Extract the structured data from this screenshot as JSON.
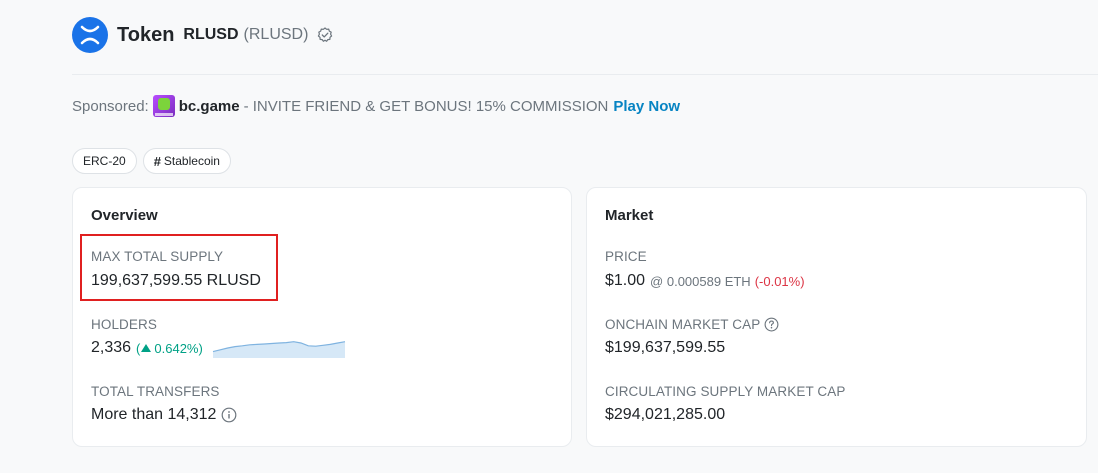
{
  "header": {
    "label": "Token",
    "name": "RLUSD",
    "symbol": "(RLUSD)"
  },
  "sponsor": {
    "prefix": "Sponsored:",
    "brand": "bc.game",
    "text": "- INVITE FRIEND & GET BONUS! 15% COMMISSION",
    "cta": "Play Now"
  },
  "tags": [
    {
      "label": "ERC-20"
    },
    {
      "label": "Stablecoin",
      "icon": "hash-icon"
    }
  ],
  "overview": {
    "title": "Overview",
    "max_supply_label": "MAX TOTAL SUPPLY",
    "max_supply_value": "199,637,599.55 RLUSD",
    "holders_label": "HOLDERS",
    "holders_value": "2,336",
    "holders_change": "0.642%)",
    "holders_change_prefix": "(",
    "transfers_label": "TOTAL TRANSFERS",
    "transfers_value": "More than 14,312",
    "holders_trend": [
      0.3,
      0.4,
      0.5,
      0.58,
      0.62,
      0.68,
      0.7,
      0.72,
      0.75,
      0.78,
      0.8,
      0.85,
      0.78,
      0.62,
      0.6,
      0.65,
      0.7,
      0.78,
      0.85
    ]
  },
  "market": {
    "title": "Market",
    "price_label": "PRICE",
    "price_value": "$1.00",
    "price_eth": "@ 0.000589 ETH",
    "price_change": "(-0.01%)",
    "mcap_label": "ONCHAIN MARKET CAP",
    "mcap_value": "$199,637,599.55",
    "circ_label": "CIRCULATING SUPPLY MARKET CAP",
    "circ_value": "$294,021,285.00"
  },
  "colors": {
    "accent": "#0784c3",
    "positive": "#00a186",
    "negative": "#dc3545",
    "highlight": "#e02020",
    "logo": "#1a73e8"
  }
}
